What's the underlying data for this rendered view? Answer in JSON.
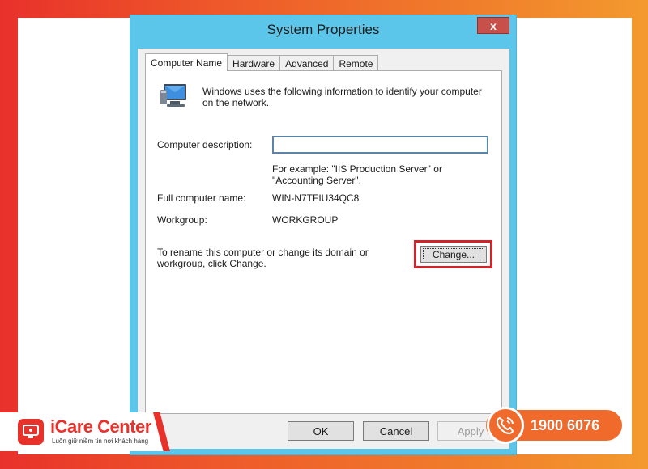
{
  "window": {
    "title": "System Properties",
    "close_label": "x"
  },
  "tabs": [
    {
      "label": "Computer Name"
    },
    {
      "label": "Hardware"
    },
    {
      "label": "Advanced"
    },
    {
      "label": "Remote"
    }
  ],
  "computer_name_tab": {
    "intro": "Windows uses the following information to identify your computer on the network.",
    "description_label": "Computer description:",
    "description_value": "",
    "example_text": "For example: \"IIS Production Server\" or \"Accounting Server\".",
    "full_name_label": "Full computer name:",
    "full_name_value": "WIN-N7TFIU34QC8",
    "workgroup_label": "Workgroup:",
    "workgroup_value": "WORKGROUP",
    "rename_text": "To rename this computer or change its domain or workgroup, click Change.",
    "change_label": "Change..."
  },
  "buttons": {
    "ok": "OK",
    "cancel": "Cancel",
    "apply": "Apply"
  },
  "brand": {
    "name": "iCare Center",
    "slogan": "Luôn giữ niềm tin nơi khách hàng",
    "hotline": "1900 6076"
  },
  "colors": {
    "titlebar": "#5cc6ea",
    "highlight": "#d2232a",
    "brand": "#e8312b",
    "hotline_bg": "#f06a2b"
  },
  "icons": {
    "computer": "computer-monitor-icon",
    "close": "close-icon",
    "phone": "phone-icon",
    "logo": "icare-logo-icon"
  }
}
